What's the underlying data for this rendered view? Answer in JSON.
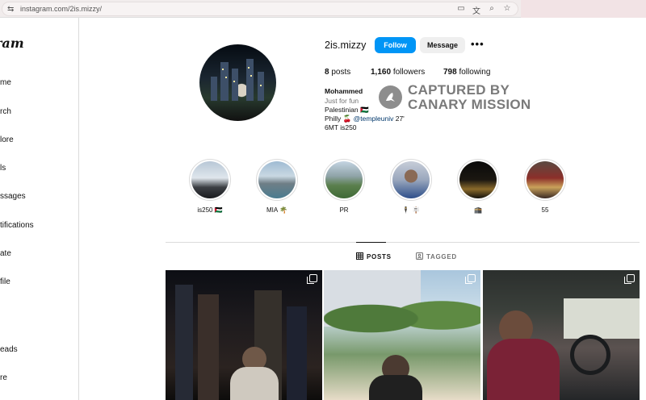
{
  "browser": {
    "url": "instagram.com/2is.mizzy/"
  },
  "sidebar": {
    "logo": "ram",
    "items": [
      {
        "label": "me"
      },
      {
        "label": "rch"
      },
      {
        "label": "lore"
      },
      {
        "label": "ls"
      },
      {
        "label": "ssages"
      },
      {
        "label": "tifications"
      },
      {
        "label": "ate"
      },
      {
        "label": "file"
      },
      {
        "label": "eads"
      },
      {
        "label": "re"
      }
    ]
  },
  "profile": {
    "username": "2is.mizzy",
    "follow_label": "Follow",
    "message_label": "Message",
    "more_label": "•••",
    "stats": {
      "posts_count": "8",
      "posts_label": "posts",
      "followers_count": "1,160",
      "followers_label": "followers",
      "following_count": "798",
      "following_label": "following"
    },
    "bio": {
      "name": "Mohammed",
      "category": "Just for fun",
      "line1": "Palestinian 🇵🇸",
      "line2_prefix": "Philly 🍒 ",
      "line2_mention": "@templeuniv",
      "line2_suffix": " 27'",
      "line3": "6MT is250"
    }
  },
  "watermark": {
    "line1": "CAPTURED BY",
    "line2": "CANARY MISSION"
  },
  "highlights": [
    {
      "label": "is250 🇵🇸"
    },
    {
      "label": "MIA 🌴"
    },
    {
      "label": "PR"
    },
    {
      "label": "🕴 🪧"
    },
    {
      "label": "🕋"
    },
    {
      "label": "55"
    }
  ],
  "tabs": {
    "posts": "POSTS",
    "tagged": "TAGGED"
  },
  "colors": {
    "accent": "#0095f6",
    "mention": "#00376b"
  }
}
